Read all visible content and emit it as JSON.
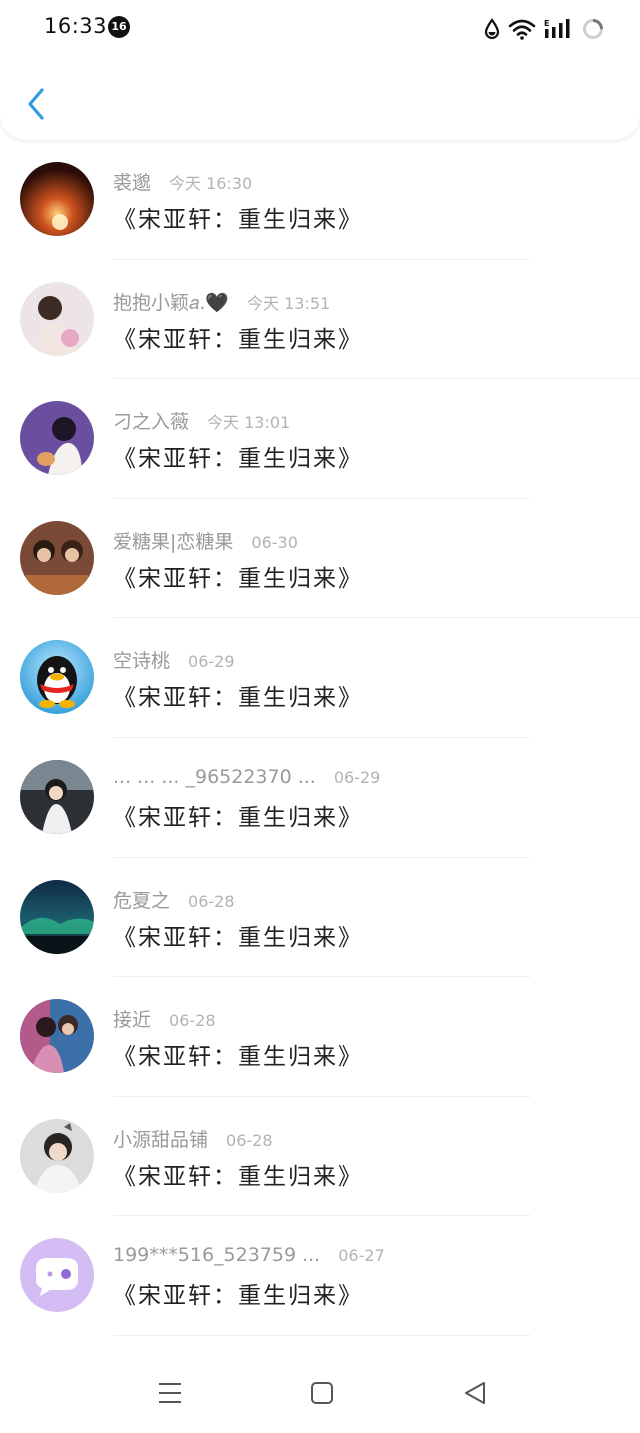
{
  "status_bar": {
    "time": "16:33",
    "notification_count": "16"
  },
  "header": {
    "back_icon": "chevron-left-icon",
    "accent_color": "#2f9be0"
  },
  "items": [
    {
      "name": "裘邈",
      "time": "今天 16:30",
      "message": "《宋亚轩：重生归来》"
    },
    {
      "name": "抱抱小颖𝑎.🖤",
      "time": "今天 13:51",
      "message": "《宋亚轩：重生归来》"
    },
    {
      "name": "刁之入薇",
      "time": "今天 13:01",
      "message": "《宋亚轩：重生归来》"
    },
    {
      "name": "爱糖果|恋糖果",
      "time": "06-30",
      "message": "《宋亚轩：重生归来》"
    },
    {
      "name": "空诗桃",
      "time": "06-29",
      "message": "《宋亚轩：重生归来》"
    },
    {
      "name": "... ... ... _96522370 ...",
      "time": "06-29",
      "message": "《宋亚轩：重生归来》"
    },
    {
      "name": "危夏之",
      "time": "06-28",
      "message": "《宋亚轩：重生归来》"
    },
    {
      "name": "接近",
      "time": "06-28",
      "message": "《宋亚轩：重生归来》"
    },
    {
      "name": "小源甜品铺",
      "time": "06-28",
      "message": "《宋亚轩：重生归来》"
    },
    {
      "name": "199***516_523759 ...",
      "time": "06-27",
      "message": "《宋亚轩：重生归来》"
    }
  ],
  "nav_bar": {
    "menu_icon": "menu-icon",
    "home_icon": "square-home-icon",
    "back_icon": "triangle-back-icon"
  }
}
